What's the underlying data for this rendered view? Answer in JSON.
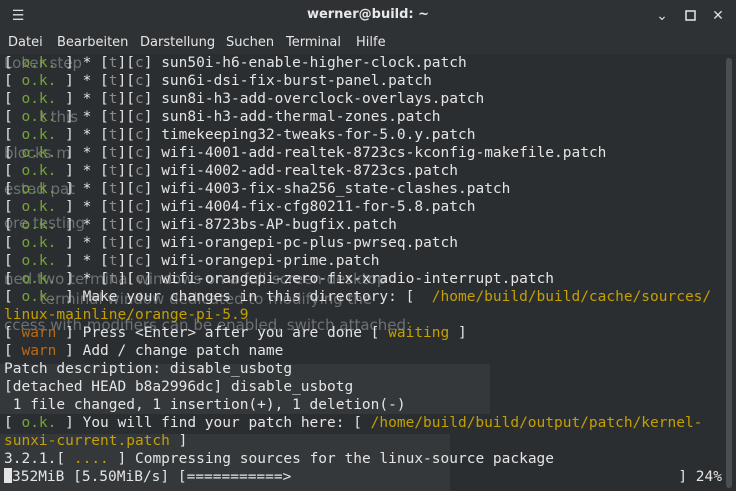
{
  "window": {
    "title": "werner@build: ~"
  },
  "menu": [
    "Datei",
    "Bearbeiten",
    "Darstellung",
    "Suchen",
    "Terminal",
    "Hilfe"
  ],
  "patches": [
    "sun50i-h6-enable-higher-clock.patch",
    "sun6i-dsi-fix-burst-panel.patch",
    "sun8i-h3-add-overclock-overlays.patch",
    "sun8i-h3-add-thermal-zones.patch",
    "timekeeping32-tweaks-for-5.0.y.patch",
    "wifi-4001-add-realtek-8723cs-kconfig-makefile.patch",
    "wifi-4002-add-realtek-8723cs.patch",
    "wifi-4003-fix-sha256_state-clashes.patch",
    "wifi-4004-fix-cfg80211-for-5.8.patch",
    "wifi-8723bs-AP-bugfix.patch",
    "wifi-orangepi-pc-plus-pwrseq.patch",
    "wifi-orangepi-prime.patch",
    "wifi-orangepi-zero-fix-xradio-interrupt.patch"
  ],
  "tags": {
    "ok": " o.k. ",
    "warn": " warn ",
    "dots": " .... ",
    "status_l": "t",
    "status_c": "c"
  },
  "lines": {
    "dir_msg": " Make your changes in this directory: [ ",
    "dir_path_1": " /home/build/build/cache/sources/",
    "dir_path_2": "linux-mainline/orange-pi-5.9",
    "press_msg": " Press <Enter> after you are done [ ",
    "press_state": "waiting",
    "add_msg": " Add / change patch name",
    "desc": "Patch description: disable_usbotg",
    "head": "[detached HEAD b8a2996dc] disable_usbotg",
    "changed": " 1 file changed, 1 insertion(+), 1 deletion(-)",
    "find_msg": " You will find your patch here: [ ",
    "find_path_1": "/home/build/build/output/patch/kernel-",
    "find_path_2": "sunxi-current.patch",
    "compress_prefix": "3.2.1.",
    "compress_msg": " Compressing sources for the linux-source package",
    "progress": "352MiB [5.50MiB/s] [===========>",
    "percent": "] 24%"
  },
  "ghost_text": [
    "Loker step",
    "t this",
    "blocks m",
    "ested pat",
    "ore testing",
    "ned two terminal windows on a full-screen desktop",
    "terminal window dedicated to modifying the",
    "ccess with modifiers can be enabled, switch attached:"
  ]
}
